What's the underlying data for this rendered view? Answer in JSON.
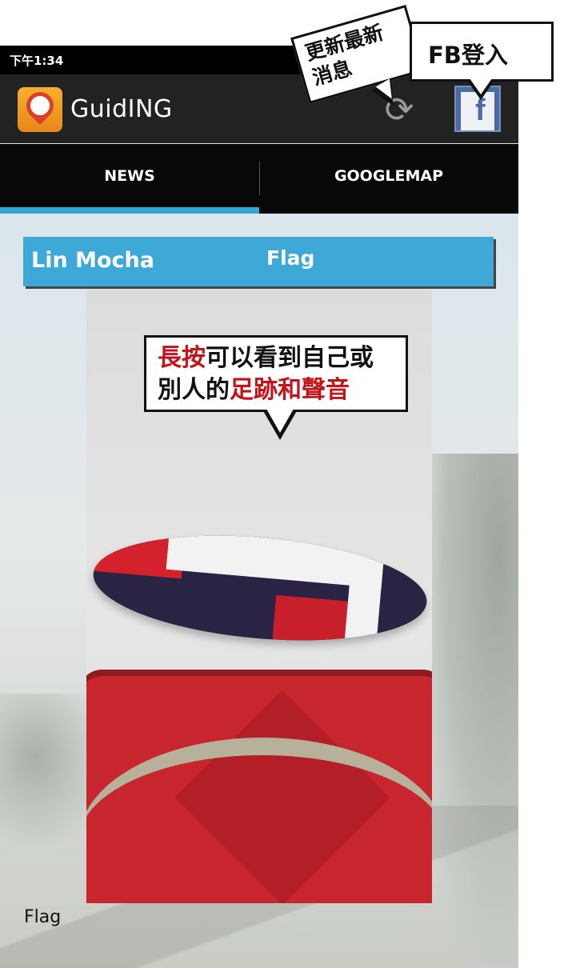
{
  "statusbar": {
    "time": "下午1:34"
  },
  "actionbar": {
    "app_title": "GuidING",
    "app_icon_text": "GuidiNG",
    "refresh_icon": "refresh-icon",
    "fb_icon": "facebook-icon"
  },
  "tabs": [
    {
      "label": "NEWS",
      "selected": true
    },
    {
      "label": "GOOGLEMAP",
      "selected": false
    }
  ],
  "colors": {
    "accent": "#33a5d8",
    "card_header": "#3ea8d6",
    "actionbar": "#222222",
    "highlight_red": "#c3141b"
  },
  "card": {
    "author": "Lin Mocha",
    "title": "Flag",
    "caption": "Flag"
  },
  "callouts": {
    "refresh": {
      "line1": "更新最新",
      "line2": "消息"
    },
    "fb": {
      "text": "FB登入"
    },
    "long_press": {
      "part1_red": "長按",
      "part2": "可以看到自己或",
      "part3": "別人的",
      "part4_red": "足跡和聲音"
    }
  }
}
